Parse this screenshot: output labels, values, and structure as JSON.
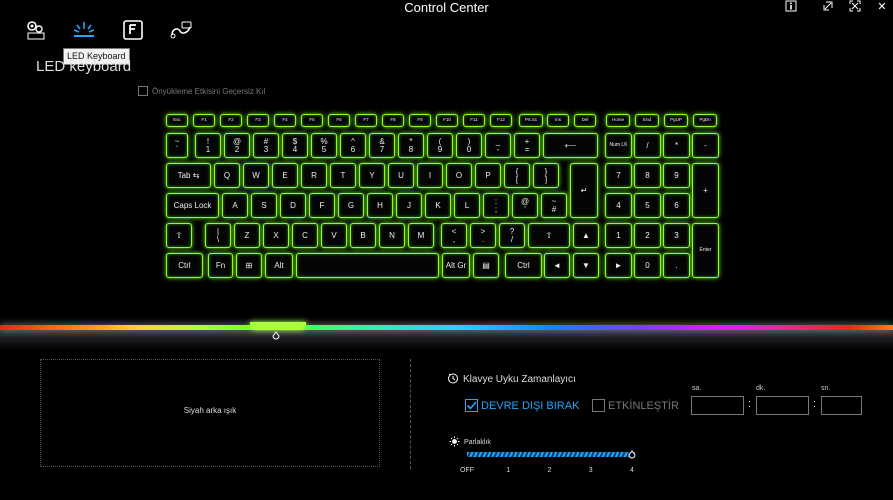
{
  "app": {
    "title": "Control Center"
  },
  "toolbar": {
    "icons": [
      "settings-icon",
      "led-keyboard-icon",
      "function-key-icon",
      "fan-cable-icon"
    ],
    "tooltip": "LED Keyboard"
  },
  "page": {
    "title": "LED keyboard"
  },
  "preview_override": {
    "label": "Önyükleme Etkisini Geçersiz Kıl",
    "checked": false
  },
  "keyboard": {
    "rows": [
      [
        "Esc",
        "F1",
        "F2",
        "F3",
        "F4",
        "F5",
        "F6",
        "F7",
        "F8",
        "F9",
        "F10",
        "F11",
        "F12",
        "Prt.Sc",
        "Ins",
        "Del",
        "Home",
        "End",
        "PgUP",
        "PgDn"
      ],
      [
        "~\n`",
        "!\n1",
        "@\n2",
        "#\n3",
        "$\n4",
        "%\n5",
        "^\n6",
        "&\n7",
        "*\n8",
        "(\n9",
        ")\n0",
        "_\n-",
        "+\n=",
        "⟵",
        "Num LK",
        "/",
        "*",
        "-"
      ],
      [
        "Tab ⇆",
        "Q",
        "W",
        "E",
        "R",
        "T",
        "Y",
        "U",
        "I",
        "O",
        "P",
        "{\n[",
        "}\n]",
        "↵",
        "7",
        "8",
        "9",
        "+"
      ],
      [
        "Caps Lock",
        "A",
        "S",
        "D",
        "F",
        "G",
        "H",
        "J",
        "K",
        "L",
        ":\n;",
        "@\n'",
        "~\n#",
        "4",
        "5",
        "6"
      ],
      [
        "⇧",
        "|\n\\",
        "Z",
        "X",
        "C",
        "V",
        "B",
        "N",
        "M",
        "<\n,",
        ">\n.",
        "?\n/",
        "⇧",
        "▲",
        "1",
        "2",
        "3",
        "Enter"
      ],
      [
        "Ctrl",
        "Fn",
        "⊞",
        "Alt",
        "",
        "Alt Gr",
        "▤",
        "Ctrl",
        "◄",
        "▼",
        "►",
        "0",
        "."
      ]
    ]
  },
  "preview_panel": {
    "label": "Siyah arka ışık"
  },
  "sleep_timer": {
    "title": "Klavye Uyku Zamanlayıcı",
    "disable_label": "DEVRE DIŞI BIRAK",
    "disable_checked": true,
    "enable_label": "ETKİNLEŞTİR",
    "enable_checked": false,
    "hours_label": "sa.",
    "minutes_label": "dk.",
    "seconds_label": "sn.",
    "separator": ":",
    "hours_value": "",
    "minutes_value": "",
    "seconds_value": ""
  },
  "brightness": {
    "title": "Parlaklık",
    "levels": [
      "OFF",
      "1",
      "2",
      "3",
      "4"
    ],
    "value": 4,
    "max": 4
  },
  "colors": {
    "key_glow": "#8cff28",
    "accent": "#1ea7ff",
    "selected_color": "#a8ff3a"
  }
}
